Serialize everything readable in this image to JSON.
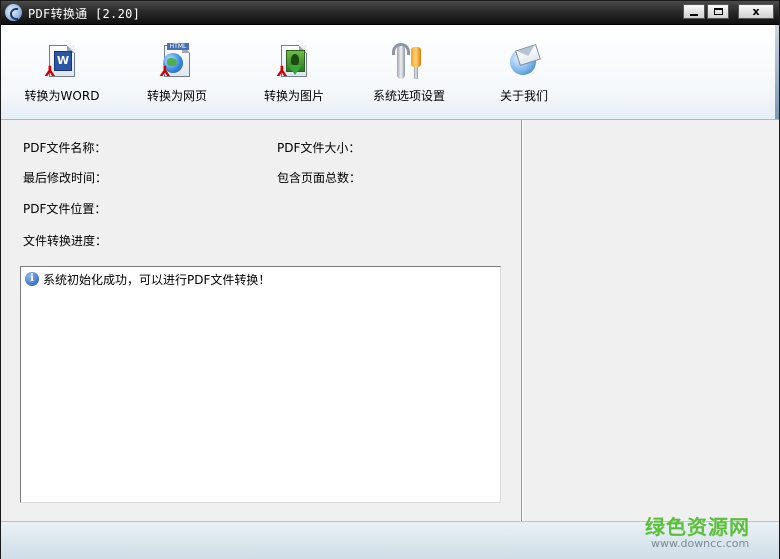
{
  "window": {
    "title": "PDF转换通 [2.20]",
    "controls": {
      "minimize": "",
      "maximize": "",
      "close": "x"
    }
  },
  "toolbar": {
    "items": [
      {
        "label": "转换为WORD",
        "icon": "pdf-to-word-icon"
      },
      {
        "label": "转换为网页",
        "icon": "pdf-to-html-icon"
      },
      {
        "label": "转换为图片",
        "icon": "pdf-to-image-icon"
      },
      {
        "label": "系统选项设置",
        "icon": "settings-tools-icon"
      },
      {
        "label": "关于我们",
        "icon": "about-mail-icon"
      }
    ]
  },
  "info": {
    "file_name_label": "PDF文件名称：",
    "file_size_label": "PDF文件大小：",
    "modified_label": "最后修改时间：",
    "page_count_label": "包含页面总数：",
    "location_label": "PDF文件位置：",
    "progress_label": "文件转换进度："
  },
  "log": {
    "entries": [
      {
        "icon": "info-icon",
        "text": "系统初始化成功，可以进行PDF文件转换！"
      }
    ]
  },
  "watermark": {
    "text": "绿色资源网",
    "url": "www.downcc.com"
  },
  "colors": {
    "titlebar": "#1f1f1f",
    "watermark_green": "#5cbf3a",
    "pdf_red": "#d10000"
  }
}
